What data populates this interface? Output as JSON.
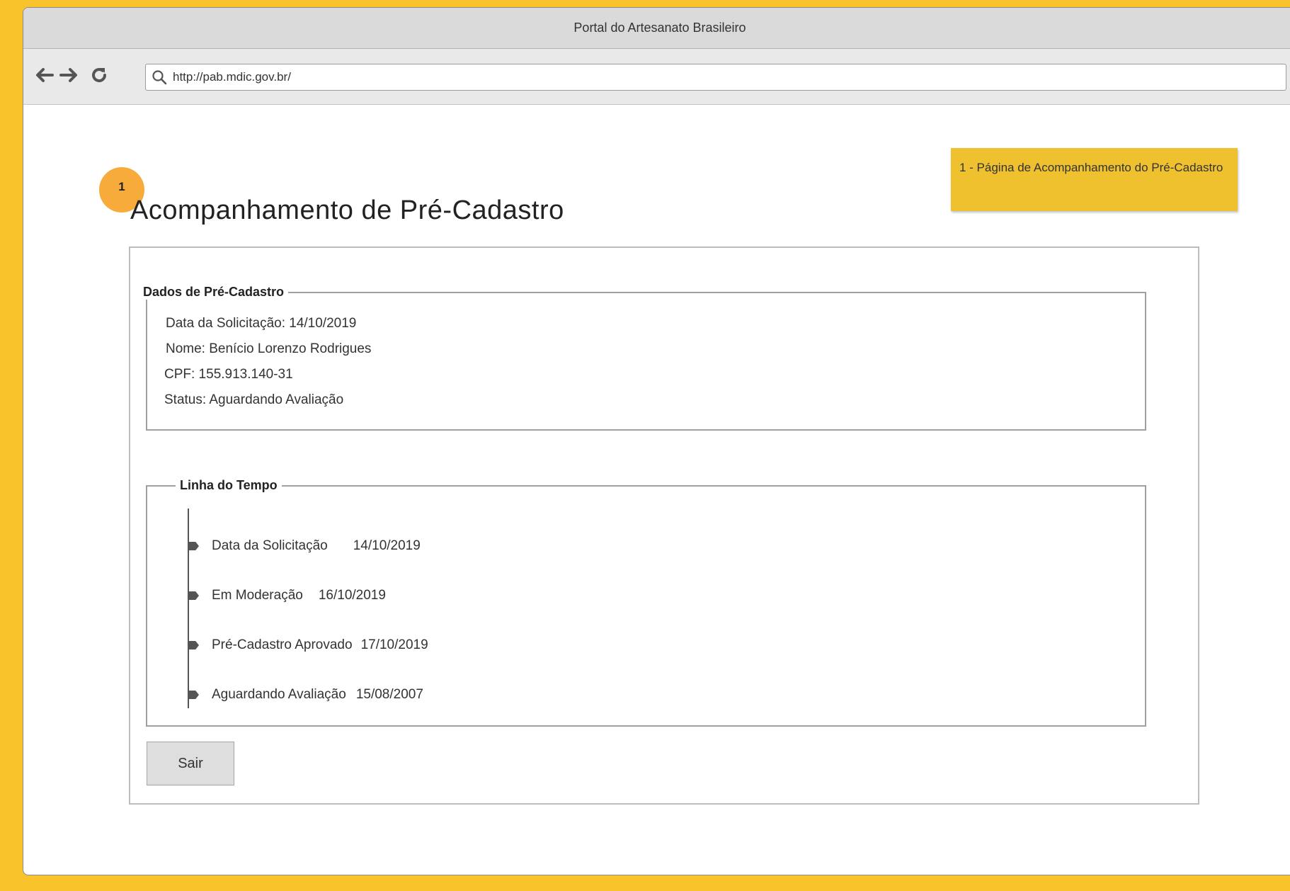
{
  "browser": {
    "window_title": "Portal do Artesanato Brasileiro",
    "url": "http://pab.mdic.gov.br/"
  },
  "annotation": {
    "badge_number": "1",
    "note": "1 - Página de Acompanhamento do Pré-Cadastro"
  },
  "page": {
    "title": "Acompanhamento de Pré-Cadastro"
  },
  "dados": {
    "legend": "Dados de Pré-Cadastro",
    "lines": [
      "Data da Solicitação: 14/10/2019",
      "Nome: Benício Lorenzo Rodrigues",
      "CPF: 155.913.140-31",
      "Status: Aguardando Avaliação"
    ]
  },
  "timeline": {
    "legend": "Linha do Tempo",
    "items": [
      {
        "label": "Data da Solicitação",
        "date": "14/10/2019"
      },
      {
        "label": "Em Moderação",
        "date": "16/10/2019"
      },
      {
        "label": "Pré-Cadastro Aprovado",
        "date": "17/10/2019"
      },
      {
        "label": "Aguardando Avaliação",
        "date": "15/08/2007"
      }
    ]
  },
  "actions": {
    "sair_label": "Sair"
  },
  "colors": {
    "sticky_note": "#efc12e",
    "badge": "#f6ab3a",
    "frame": "#f9c32b"
  }
}
